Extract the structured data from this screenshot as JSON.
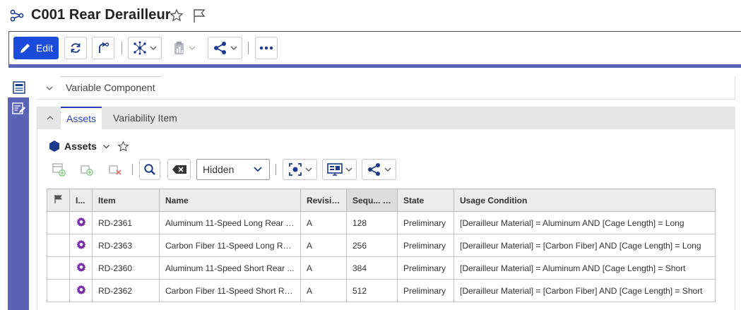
{
  "header": {
    "title": "C001 Rear Derailleur",
    "title_icon": "structure-icon",
    "favorite_icon": "star-outline-icon",
    "flag_icon": "flag-outline-icon"
  },
  "toolbar": {
    "edit_label": "Edit",
    "accent_color": "#1a4bdb",
    "band_color": "#5a63b5"
  },
  "sections": {
    "variable_component_tab": "Variable Component",
    "assets_tab": "Assets",
    "variability_item_tab": "Variability Item"
  },
  "assets": {
    "title": "Assets",
    "filter_select": "Hidden"
  },
  "grid": {
    "columns": [
      "I...",
      "Item",
      "Name",
      "Revision",
      "Sequ...",
      "State",
      "Usage Condition"
    ],
    "rows": [
      {
        "item": "RD-2361",
        "name": "Aluminum 11-Speed Long Rear D...",
        "revision": "A",
        "sequence": "128",
        "state": "Preliminary",
        "usage_condition": "[Derailleur Material] = Aluminum AND [Cage Length] = Long"
      },
      {
        "item": "RD-2363",
        "name": "Carbon Fiber 11-Speed Long Rea...",
        "revision": "A",
        "sequence": "256",
        "state": "Preliminary",
        "usage_condition": "[Derailleur Material] = [Carbon Fiber] AND [Cage Length] = Long"
      },
      {
        "item": "RD-2360",
        "name": "Aluminum 11-Speed Short Rear ...",
        "revision": "A",
        "sequence": "384",
        "state": "Preliminary",
        "usage_condition": "[Derailleur Material] = Aluminum AND [Cage Length] = Short"
      },
      {
        "item": "RD-2362",
        "name": "Carbon Fiber 11-Speed Short Re...",
        "revision": "A",
        "sequence": "512",
        "state": "Preliminary",
        "usage_condition": "[Derailleur Material] = [Carbon Fiber] AND [Cage Length] = Short"
      }
    ]
  }
}
